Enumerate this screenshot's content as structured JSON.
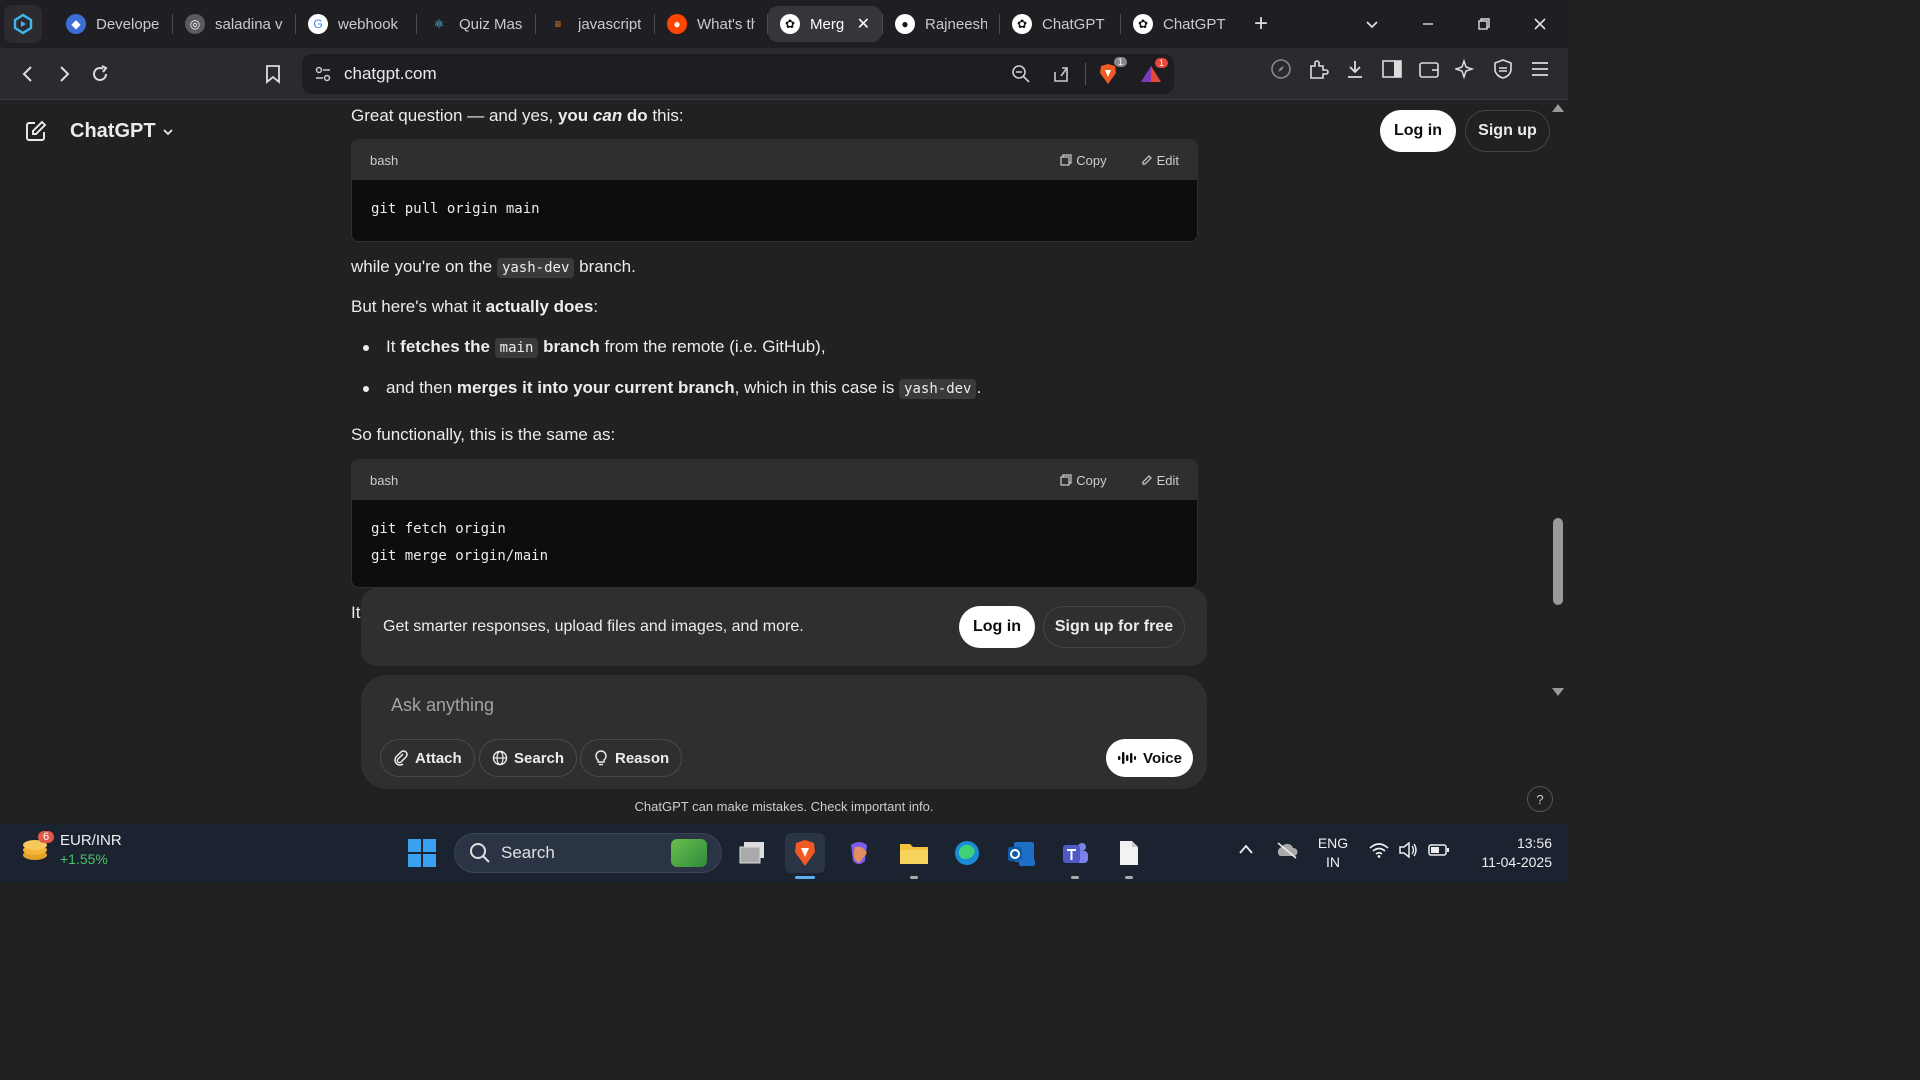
{
  "browser": {
    "tabs": [
      {
        "label": "Develope",
        "icon": "shield-icon",
        "active": false
      },
      {
        "label": "saladina v",
        "icon": "globe-icon",
        "active": false
      },
      {
        "label": "webhook",
        "icon": "google-icon",
        "active": false
      },
      {
        "label": "Quiz Mas",
        "icon": "react-icon",
        "active": false
      },
      {
        "label": "javascript",
        "icon": "stackoverflow-icon",
        "active": false
      },
      {
        "label": "What's th",
        "icon": "reddit-icon",
        "active": false
      },
      {
        "label": "Merg",
        "icon": "chatgpt-icon",
        "active": true
      },
      {
        "label": "Rajneesh",
        "icon": "github-icon",
        "active": false
      },
      {
        "label": "ChatGPT",
        "icon": "chatgpt-icon",
        "active": false
      },
      {
        "label": "ChatGPT",
        "icon": "chatgpt-icon",
        "active": false
      }
    ],
    "url": "chatgpt.com",
    "brave_badge": "1",
    "rewards_badge": "1"
  },
  "header": {
    "brand": "ChatGPT",
    "login_label": "Log in",
    "signup_label": "Sign up"
  },
  "message": {
    "intro_pre": "Great question — and yes, ",
    "intro_bold": "you ",
    "intro_boldit": "can",
    "intro_bold2": " do",
    "intro_post": " this:",
    "code1": {
      "lang": "bash",
      "copy": "Copy",
      "edit": "Edit",
      "code": "git pull origin main"
    },
    "p2_pre": "while you're on the ",
    "p2_code": "yash-dev",
    "p2_post": " branch.",
    "p3_pre": "But here's what it ",
    "p3_bold": "actually does",
    "p3_post": ":",
    "b1_pre": "It ",
    "b1_bold": "fetches the ",
    "b1_code": "main",
    "b1_bold2": " branch",
    "b1_post": " from the remote (i.e. GitHub),",
    "b2_pre": "and then ",
    "b2_bold": "merges it into your current branch",
    "b2_mid": ", which in this case is ",
    "b2_code": "yash-dev",
    "b2_post": ".",
    "p4": "So functionally, this is the same as:",
    "code2": {
      "lang": "bash",
      "copy": "Copy",
      "edit": "Edit",
      "code": "git fetch origin\ngit merge origin/main"
    },
    "trailing": "It"
  },
  "banner": {
    "text": "Get smarter responses, upload files and images, and more.",
    "login": "Log in",
    "signup": "Sign up for free"
  },
  "composer": {
    "placeholder": "Ask anything",
    "attach": "Attach",
    "search": "Search",
    "reason": "Reason",
    "voice": "Voice"
  },
  "footer_note": "ChatGPT can make mistakes. Check important info.",
  "help": "?",
  "taskbar": {
    "widget_title": "EUR/INR",
    "widget_value": "+1.55%",
    "widget_badge": "6",
    "search": "Search",
    "lang1": "ENG",
    "lang2": "IN",
    "time": "13:56",
    "date": "11-04-2025"
  }
}
